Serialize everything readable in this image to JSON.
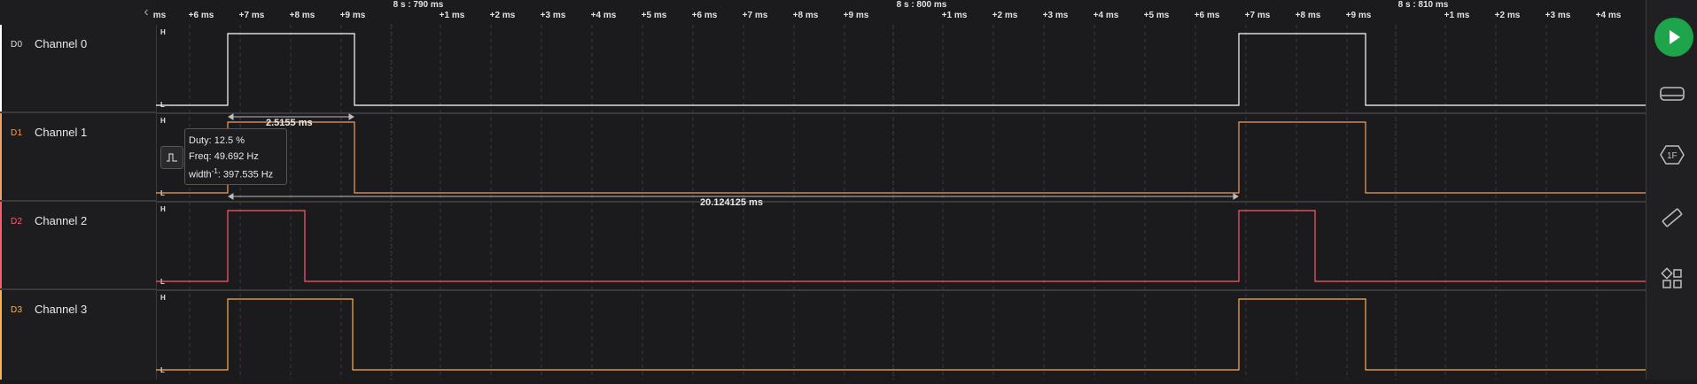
{
  "ruler": {
    "ticks": [
      "ms",
      "+6 ms",
      "+7 ms",
      "+8 ms",
      "+9 ms",
      "+1 ms",
      "+2 ms",
      "+3 ms",
      "+4 ms",
      "+5 ms",
      "+6 ms",
      "+7 ms",
      "+8 ms",
      "+9 ms",
      "+1 ms",
      "+2 ms",
      "+3 ms",
      "+4 ms",
      "+5 ms",
      "+6 ms",
      "+7 ms",
      "+8 ms",
      "+9 ms",
      "+1 ms",
      "+2 ms",
      "+3 ms",
      "+4 ms"
    ],
    "majors": [
      "8 s : 790 ms",
      "8 s : 800 ms",
      "8 s : 810 ms"
    ]
  },
  "channels": [
    {
      "id": "D0",
      "name": "Channel 0",
      "color": "#ffffff",
      "high": "H",
      "low": "L"
    },
    {
      "id": "D1",
      "name": "Channel 1",
      "color": "#f0a060",
      "high": "H",
      "low": "L"
    },
    {
      "id": "D2",
      "name": "Channel 2",
      "color": "#ff5a6a",
      "high": "H",
      "low": "L"
    },
    {
      "id": "D3",
      "name": "Channel 3",
      "color": "#ffb14a",
      "high": "H",
      "low": "L"
    }
  ],
  "measurements": {
    "pulse_width": "2.5155 ms",
    "period": "20.124125 ms"
  },
  "tooltip": {
    "duty": "Duty: 12.5 %",
    "freq": "Freq: 49.692 Hz",
    "width_label": "width",
    "width_exp": "-1",
    "width_value": ": 397.535 Hz"
  },
  "toolbar": {
    "play_icon": "play-icon",
    "accent": "#1ea54c"
  }
}
